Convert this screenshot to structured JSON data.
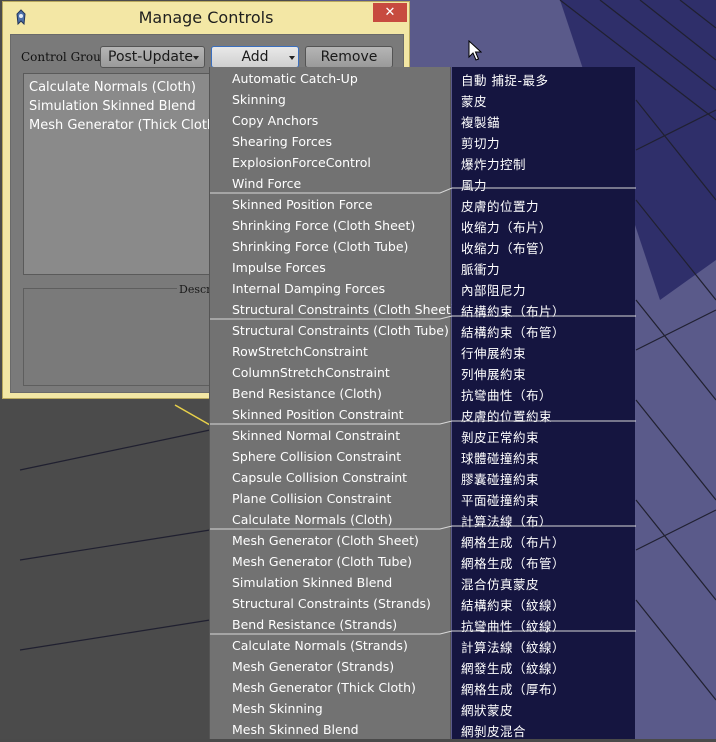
{
  "window": {
    "title": "Manage Controls",
    "close_label": "✕",
    "control_group_label": "Control Group:",
    "control_group_value": "Post-Update",
    "add_label": "Add",
    "remove_label": "Remove",
    "description_label": "Descri",
    "controls": [
      "Calculate Normals (Cloth)",
      "Simulation Skinned Blend",
      "Mesh Generator (Thick Cloth)"
    ]
  },
  "add_menu": {
    "items": [
      "Automatic Catch-Up",
      "Skinning",
      "Copy Anchors",
      "Shearing Forces",
      "ExplosionForceControl",
      "Wind Force",
      "Skinned Position Force",
      "Shrinking Force (Cloth Sheet)",
      "Shrinking Force (Cloth Tube)",
      "Impulse Forces",
      "Internal Damping Forces",
      "Structural Constraints (Cloth Sheet)",
      "Structural Constraints (Cloth Tube)",
      "RowStretchConstraint",
      "ColumnStretchConstraint",
      "Bend Resistance (Cloth)",
      "Skinned Position Constraint",
      "Skinned Normal Constraint",
      "Sphere Collision Constraint",
      "Capsule Collision Constraint",
      "Plane Collision Constraint",
      "Calculate Normals (Cloth)",
      "Mesh Generator (Cloth Sheet)",
      "Mesh Generator (Cloth Tube)",
      "Simulation Skinned Blend",
      "Structural Constraints (Strands)",
      "Bend Resistance (Strands)",
      "Calculate Normals (Strands)",
      "Mesh Generator (Strands)",
      "Mesh Generator (Thick Cloth)",
      "Mesh Skinning",
      "Mesh Skinned Blend"
    ]
  },
  "translations": [
    "自動 捕捉-最多",
    "蒙皮",
    "複製錨",
    "剪切力",
    "爆炸力控制",
    "風力",
    "皮膚的位置力",
    "收缩力（布片）",
    "收缩力（布管）",
    "脈衝力",
    "內部阻尼力",
    "結構約束（布片）",
    "結構約束（布管）",
    "行伸展約束",
    "列伸展約束",
    "抗彎曲性（布）",
    "皮膚的位置約束",
    "剝皮正常約束",
    "球體碰撞約束",
    "膠囊碰撞約束",
    "平面碰撞約束",
    "計算法線（布）",
    "網格生成（布片）",
    "網格生成（布管）",
    "混合仿真蒙皮",
    "結構約束（紋線）",
    "抗彎曲性（紋線）",
    "計算法線（紋線）",
    "網發生成（紋線）",
    "網格生成（厚布）",
    "網狀蒙皮",
    "網剝皮混合"
  ],
  "colors": {
    "window_frame": "#f3e7a5",
    "client_bg": "#7a7a7a",
    "menu_bg": "#727272",
    "translation_bg": "#151540",
    "close_button": "#c74b3f"
  }
}
